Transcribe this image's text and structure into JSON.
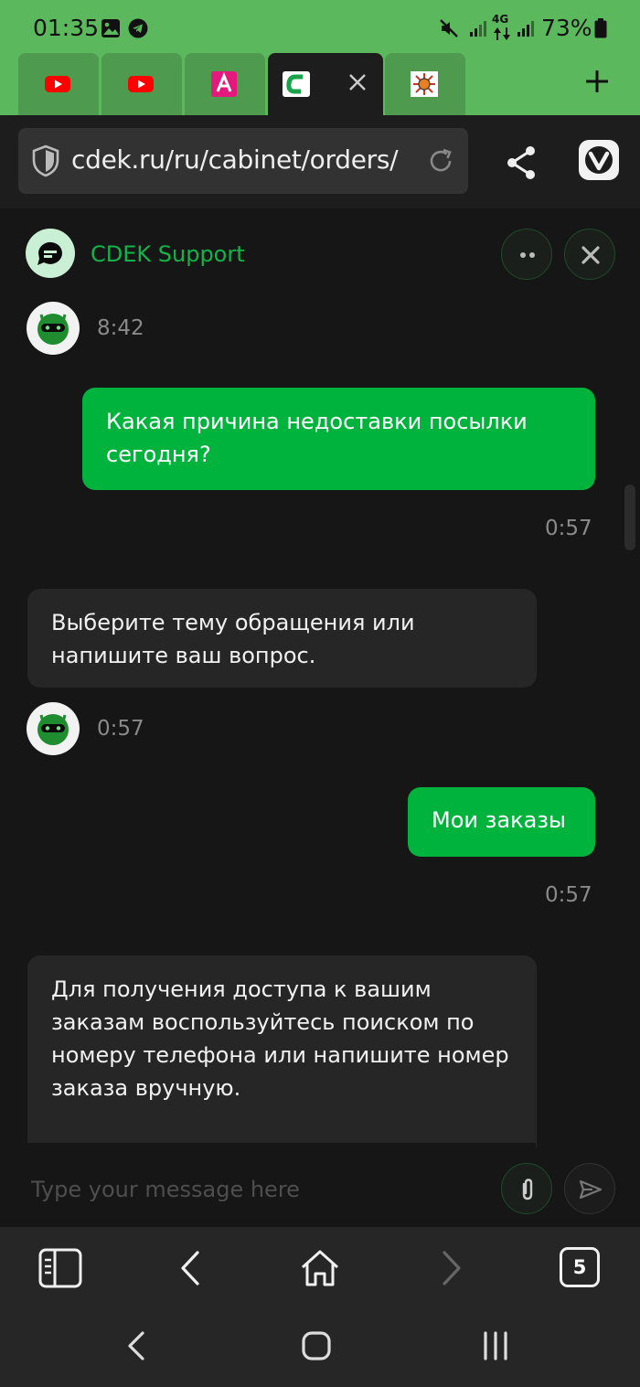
{
  "status_bar": {
    "time": "01:35",
    "battery_percent": "73%",
    "network": "4G",
    "icons": [
      "gallery-icon",
      "telegram-icon",
      "mute-icon",
      "signal-icon",
      "signal-4g-icon",
      "battery-icon"
    ]
  },
  "tabs": [
    {
      "favicon": "youtube-icon",
      "active": false
    },
    {
      "favicon": "youtube-icon",
      "active": false
    },
    {
      "favicon": "alfa-icon",
      "active": false
    },
    {
      "favicon": "cdek-icon",
      "active": true
    },
    {
      "favicon": "sun-emblem-icon",
      "active": false
    }
  ],
  "address_bar": {
    "url": "cdek.ru/ru/cabinet/orders/"
  },
  "chat": {
    "title": "CDEK Support",
    "composer_placeholder": "Type your message here",
    "messages": [
      {
        "from": "bot-time",
        "time": "8:42"
      },
      {
        "from": "user",
        "text": "Какая причина недоставки посылки\nсегодня?",
        "time": "0:57"
      },
      {
        "from": "bot",
        "text": "Выберите тему обращения или\nнапишите ваш вопрос.",
        "time": "0:57"
      },
      {
        "from": "user",
        "text": "Мои заказы",
        "time": "0:57"
      },
      {
        "from": "bot",
        "text": "Для получения доступа к вашим\nзаказам воспользуйтесь поиском по\nномеру телефона или напишите номер\nзаказа вручную."
      }
    ]
  },
  "bottom_bar": {
    "tab_count": "5"
  },
  "colors": {
    "brand_green": "#00b33c",
    "chrome_green": "#5cb85c",
    "title_green": "#14b24a",
    "bot_bubble": "#262626",
    "background": "#161616"
  }
}
